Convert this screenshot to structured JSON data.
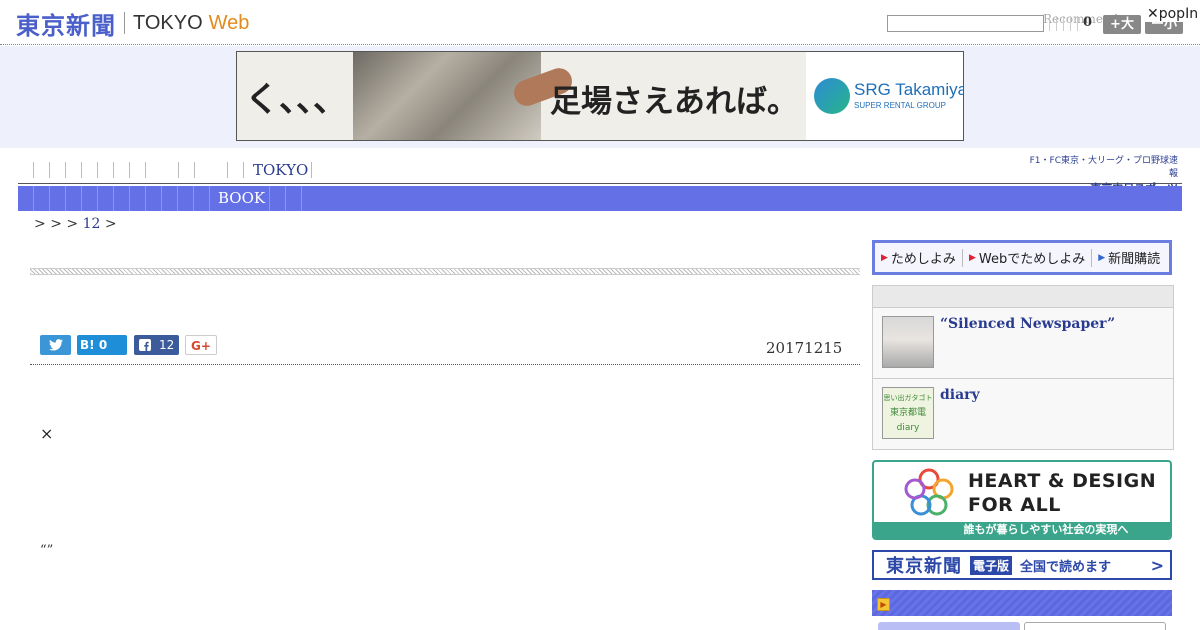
{
  "header": {
    "logo_jp": "東京新聞",
    "logo_en": "TOKYO",
    "logo_web": "Web",
    "search_placeholder": "",
    "recommend_label": "Recommend",
    "count": "0",
    "text_larger": "+大",
    "text_smaller": "ー小",
    "popin_label": "✕popIn"
  },
  "banner": {
    "left_text": "く、、、",
    "main_text": "足場さえあれば。",
    "brand_name": "SRG Takamiya",
    "brand_sub": "SUPER RENTAL GROUP"
  },
  "nav": {
    "primary_label": "TOKYO",
    "secondary_label": "BOOK",
    "chunichi_line1": "F1・FC東京・大リーグ・プロ野球速報",
    "chunichi_line2": "東京中日スポーツ"
  },
  "breadcrumb": {
    "sep1": "> ",
    "sep2": "> ",
    "sep3": "> ",
    "link": "12",
    "sep4": " >"
  },
  "article": {
    "date": "20171215",
    "times_symbol": "×",
    "quote": "“”"
  },
  "share": {
    "hatena_label": "B!",
    "hatena_count": "0",
    "facebook_count": "12",
    "gplus_label": "G+"
  },
  "sidebar": {
    "tameshi": [
      {
        "label": "ためしよみ"
      },
      {
        "label": "Webでためしよみ"
      },
      {
        "label": "新聞購読"
      }
    ],
    "recommend": [
      {
        "title": "“Silenced Newspaper”"
      },
      {
        "title": "diary",
        "thumb_text_1": "思い出ガタゴト",
        "thumb_text_2": "東京都電",
        "thumb_text_3": "diary"
      }
    ],
    "heart_line1": "HEART & DESIGN",
    "heart_line2": "FOR ALL",
    "heart_bar": "誰もが暮らしやすい社会の実現へ",
    "edition_logo": "東京新聞",
    "edition_badge": "電子版",
    "edition_text": "全国で読めます",
    "edition_arrow": ">"
  },
  "colors": {
    "nav_blue": "#6470e6",
    "banner_bg": "#eef0fb",
    "heart_green": "#3aa58b",
    "link_blue": "#2a3b8f"
  }
}
